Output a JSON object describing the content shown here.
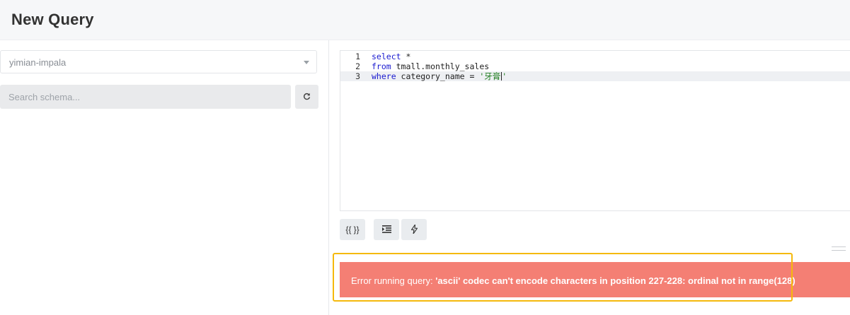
{
  "header": {
    "title": "New Query"
  },
  "left_panel": {
    "data_source": {
      "value": "yimian-impala"
    },
    "schema_search": {
      "placeholder": "Search schema..."
    }
  },
  "editor": {
    "lines": [
      {
        "number": "1",
        "tokens": [
          {
            "text": "select",
            "kind": "keyword"
          },
          {
            "text": " *",
            "kind": "plain"
          }
        ]
      },
      {
        "number": "2",
        "tokens": [
          {
            "text": "from",
            "kind": "keyword"
          },
          {
            "text": " tmall.monthly_sales",
            "kind": "plain"
          }
        ]
      },
      {
        "number": "3",
        "tokens": [
          {
            "text": "where",
            "kind": "keyword"
          },
          {
            "text": " category_name = ",
            "kind": "plain"
          },
          {
            "text": "'牙膏",
            "kind": "string"
          },
          {
            "text": "'",
            "kind": "string-after-cursor"
          }
        ]
      }
    ],
    "active_line": 3
  },
  "toolbar": {
    "params_label": "{{ }}",
    "format_icon": "indent-icon",
    "autocomplete_icon": "bolt-icon"
  },
  "error": {
    "prefix": "Error running query: ",
    "message": "'ascii' codec can't encode characters in position 227-228: ordinal not in range(128)"
  },
  "colors": {
    "error_bg": "#f47f74",
    "highlight_border": "#f5b90c",
    "keyword": "#1b1bd0",
    "string": "#1a7a1a"
  }
}
